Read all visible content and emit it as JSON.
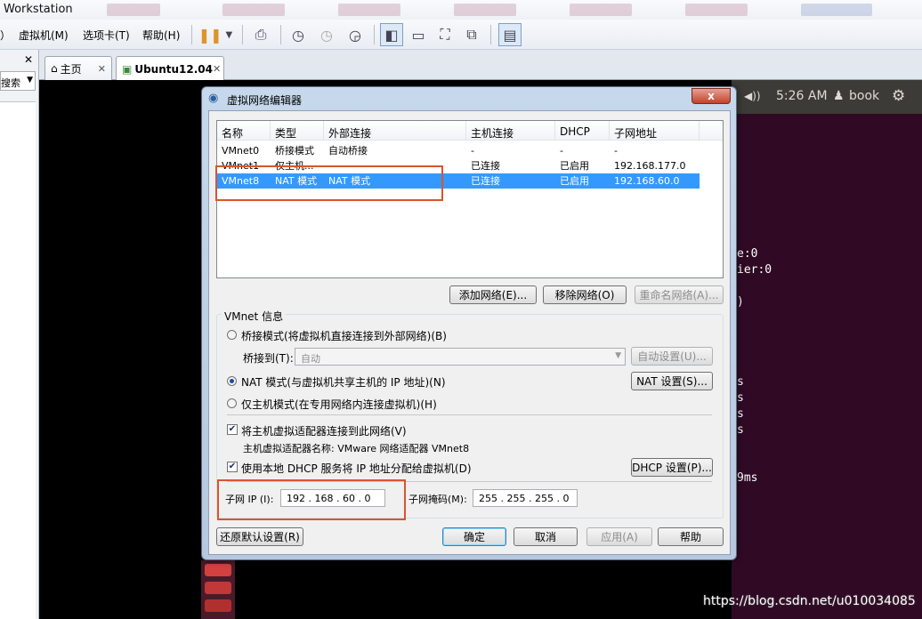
{
  "window": {
    "title": "Workstation"
  },
  "menu": [
    "）",
    "虚拟机(M)",
    "选项卡(T)",
    "帮助(H)"
  ],
  "leftpane": {
    "search_label": "搜索",
    "close": "✕"
  },
  "tabs": [
    {
      "label": "主页",
      "close": "✕"
    },
    {
      "label": "Ubuntu12.04",
      "close": "✕"
    }
  ],
  "ubuntu": {
    "clock": "5:26 AM",
    "user": "book",
    "sound": "◀))",
    "gear": "⚙",
    "terminal_lines": [
      "e:0",
      "ier:0",
      ")",
      "s",
      "s",
      "s",
      "s",
      "9ms"
    ]
  },
  "dialog": {
    "title": "虚拟网络编辑器",
    "close": "x",
    "columns": [
      "名称",
      "类型",
      "外部连接",
      "主机连接",
      "DHCP",
      "子网地址"
    ],
    "rows": [
      {
        "name": "VMnet0",
        "type": "桥接模式",
        "external": "自动桥接",
        "host": "-",
        "dhcp": "-",
        "subnet": "-"
      },
      {
        "name": "VMnet1",
        "type": "仅主机...",
        "external": "",
        "host": "已连接",
        "dhcp": "已启用",
        "subnet": "192.168.177.0"
      },
      {
        "name": "VMnet8",
        "type": "NAT 模式",
        "external": "NAT 模式",
        "host": "已连接",
        "dhcp": "已启用",
        "subnet": "192.168.60.0"
      }
    ],
    "add_network": "添加网络(E)...",
    "remove_network": "移除网络(O)",
    "rename_network": "重命名网络(A)...",
    "vmnet_info": "VMnet 信息",
    "bridge_mode": "桥接模式(将虚拟机直接连接到外部网络)(B)",
    "bridge_to": "桥接到(T):",
    "bridge_value": "自动",
    "auto_settings": "自动设置(U)...",
    "nat_mode": "NAT 模式(与虚拟机共享主机的 IP 地址)(N)",
    "nat_settings": "NAT 设置(S)...",
    "host_only": "仅主机模式(在专用网络内连接虚拟机)(H)",
    "connect_adapter": "将主机虚拟适配器连接到此网络(V)",
    "adapter_name": "主机虚拟适配器名称: VMware 网络适配器 VMnet8",
    "use_dhcp": "使用本地 DHCP 服务将 IP 地址分配给虚拟机(D)",
    "dhcp_settings": "DHCP 设置(P)...",
    "subnet_ip_label": "子网 IP (I):",
    "subnet_ip": "192 . 168 . 60 . 0",
    "subnet_mask_label": "子网掩码(M):",
    "subnet_mask": "255 . 255 . 255 . 0",
    "restore_defaults": "还原默认设置(R)",
    "ok": "确定",
    "cancel": "取消",
    "apply": "应用(A)",
    "help": "帮助"
  },
  "watermark": "https://blog.csdn.net/u010034085",
  "colors": {
    "selection": "#3399ff",
    "highlight_box": "#d9552e",
    "terminal_bg": "#300a24"
  }
}
